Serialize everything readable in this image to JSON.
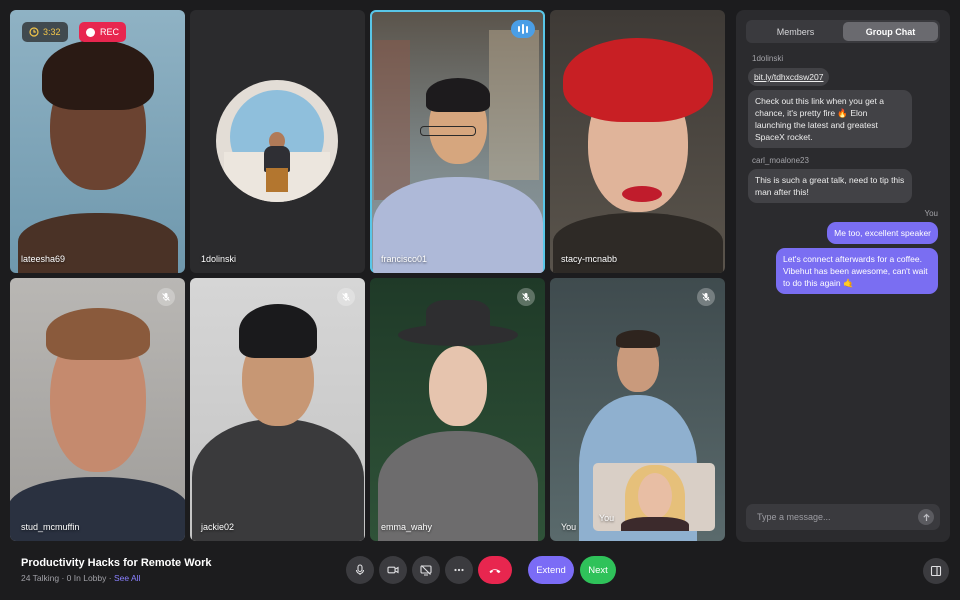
{
  "recording": {
    "timer": "3:32",
    "rec_label": "REC"
  },
  "participants": [
    {
      "name": "lateesha69"
    },
    {
      "name": "1dolinski"
    },
    {
      "name": "francisco01"
    },
    {
      "name": "stacy-mcnabb"
    },
    {
      "name": "stud_mcmuffin"
    },
    {
      "name": "jackie02"
    },
    {
      "name": "emma_wahy"
    },
    {
      "name": "You"
    }
  ],
  "pip": {
    "name": "You"
  },
  "chat": {
    "tabs": [
      "Members",
      "Group Chat"
    ],
    "selected_tab": "Group Chat",
    "messages": [
      {
        "author": "1dolinski",
        "link": "bit.ly/tdhxcdsw207",
        "text": "Check out this link when you get a chance, it's pretty fire 🔥 Elon launching the latest and greatest SpaceX rocket."
      },
      {
        "author": "carl_moalone23",
        "text": "This is such a great talk, need to tip this man after this!"
      },
      {
        "author": "You",
        "texts": [
          "Me too, excellent speaker",
          "Let's connect afterwards for a coffee. Vibehut has been awesome, can't wait to do this again 🤙"
        ]
      }
    ],
    "placeholder": "Type a message..."
  },
  "meeting": {
    "title": "Productivity Hacks for Remote Work",
    "status": "24 Talking · 0 In Lobby · ",
    "see_all": "See All"
  },
  "controls": {
    "extend": "Extend",
    "next": "Next"
  },
  "colors": {
    "accent": "#7b6cf6",
    "rec": "#e8264f",
    "next": "#2fc25a",
    "my_bubble": "#7a6ef2",
    "active_border": "#58c6e8"
  },
  "icons": [
    "clock-icon",
    "record-dot-icon",
    "mic-off-icon",
    "audio-wave-icon",
    "mic-icon",
    "camera-icon",
    "screen-share-off-icon",
    "more-icon",
    "hang-up-icon",
    "send-icon",
    "panel-toggle-icon"
  ]
}
